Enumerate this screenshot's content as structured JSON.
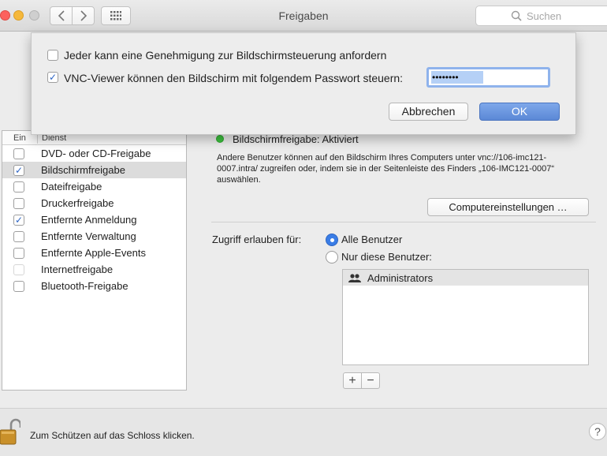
{
  "window": {
    "title": "Freigaben",
    "search_placeholder": "Suchen"
  },
  "dialog": {
    "option1_label": "Jeder kann eine Genehmigung zur Bildschirmsteuerung anfordern",
    "option1_checked": false,
    "option2_label": "VNC-Viewer können den Bildschirm mit folgendem Passwort steuern:",
    "option2_checked": true,
    "password_mask": "••••••••",
    "cancel_label": "Abbrechen",
    "ok_label": "OK"
  },
  "services": {
    "header_on": "Ein",
    "header_service": "Dienst",
    "items": [
      {
        "label": "DVD- oder CD-Freigabe",
        "checked": false
      },
      {
        "label": "Bildschirmfreigabe",
        "checked": true,
        "selected": true
      },
      {
        "label": "Dateifreigabe",
        "checked": false
      },
      {
        "label": "Druckerfreigabe",
        "checked": false
      },
      {
        "label": "Entfernte Anmeldung",
        "checked": true
      },
      {
        "label": "Entfernte Verwaltung",
        "checked": false
      },
      {
        "label": "Entfernte Apple-Events",
        "checked": false
      },
      {
        "label": "Internetfreigabe",
        "checked": false,
        "disabled": true
      },
      {
        "label": "Bluetooth-Freigabe",
        "checked": false
      }
    ]
  },
  "detail": {
    "status": "Bildschirmfreigabe: Aktiviert",
    "status_color": "#3dc23f",
    "description": "Andere Benutzer können auf den Bildschirm Ihres Computers unter vnc://106-imc121-0007.intra/ zugreifen oder, indem sie in der Seitenleiste des Finders „106-IMC121-0007“ auswählen.",
    "computer_settings_label": "Computereinstellungen …",
    "access_label": "Zugriff erlauben für:",
    "radio_all": "Alle Benutzer",
    "radio_only": "Nur diese Benutzer:",
    "users": [
      "Administrators"
    ],
    "add_label": "+",
    "remove_label": "−"
  },
  "footer": {
    "lock_text": "Zum Schützen auf das Schloss klicken.",
    "help_label": "?"
  },
  "colors": {
    "accent": "#3a7de6",
    "ok_button": "#6a97e0"
  }
}
